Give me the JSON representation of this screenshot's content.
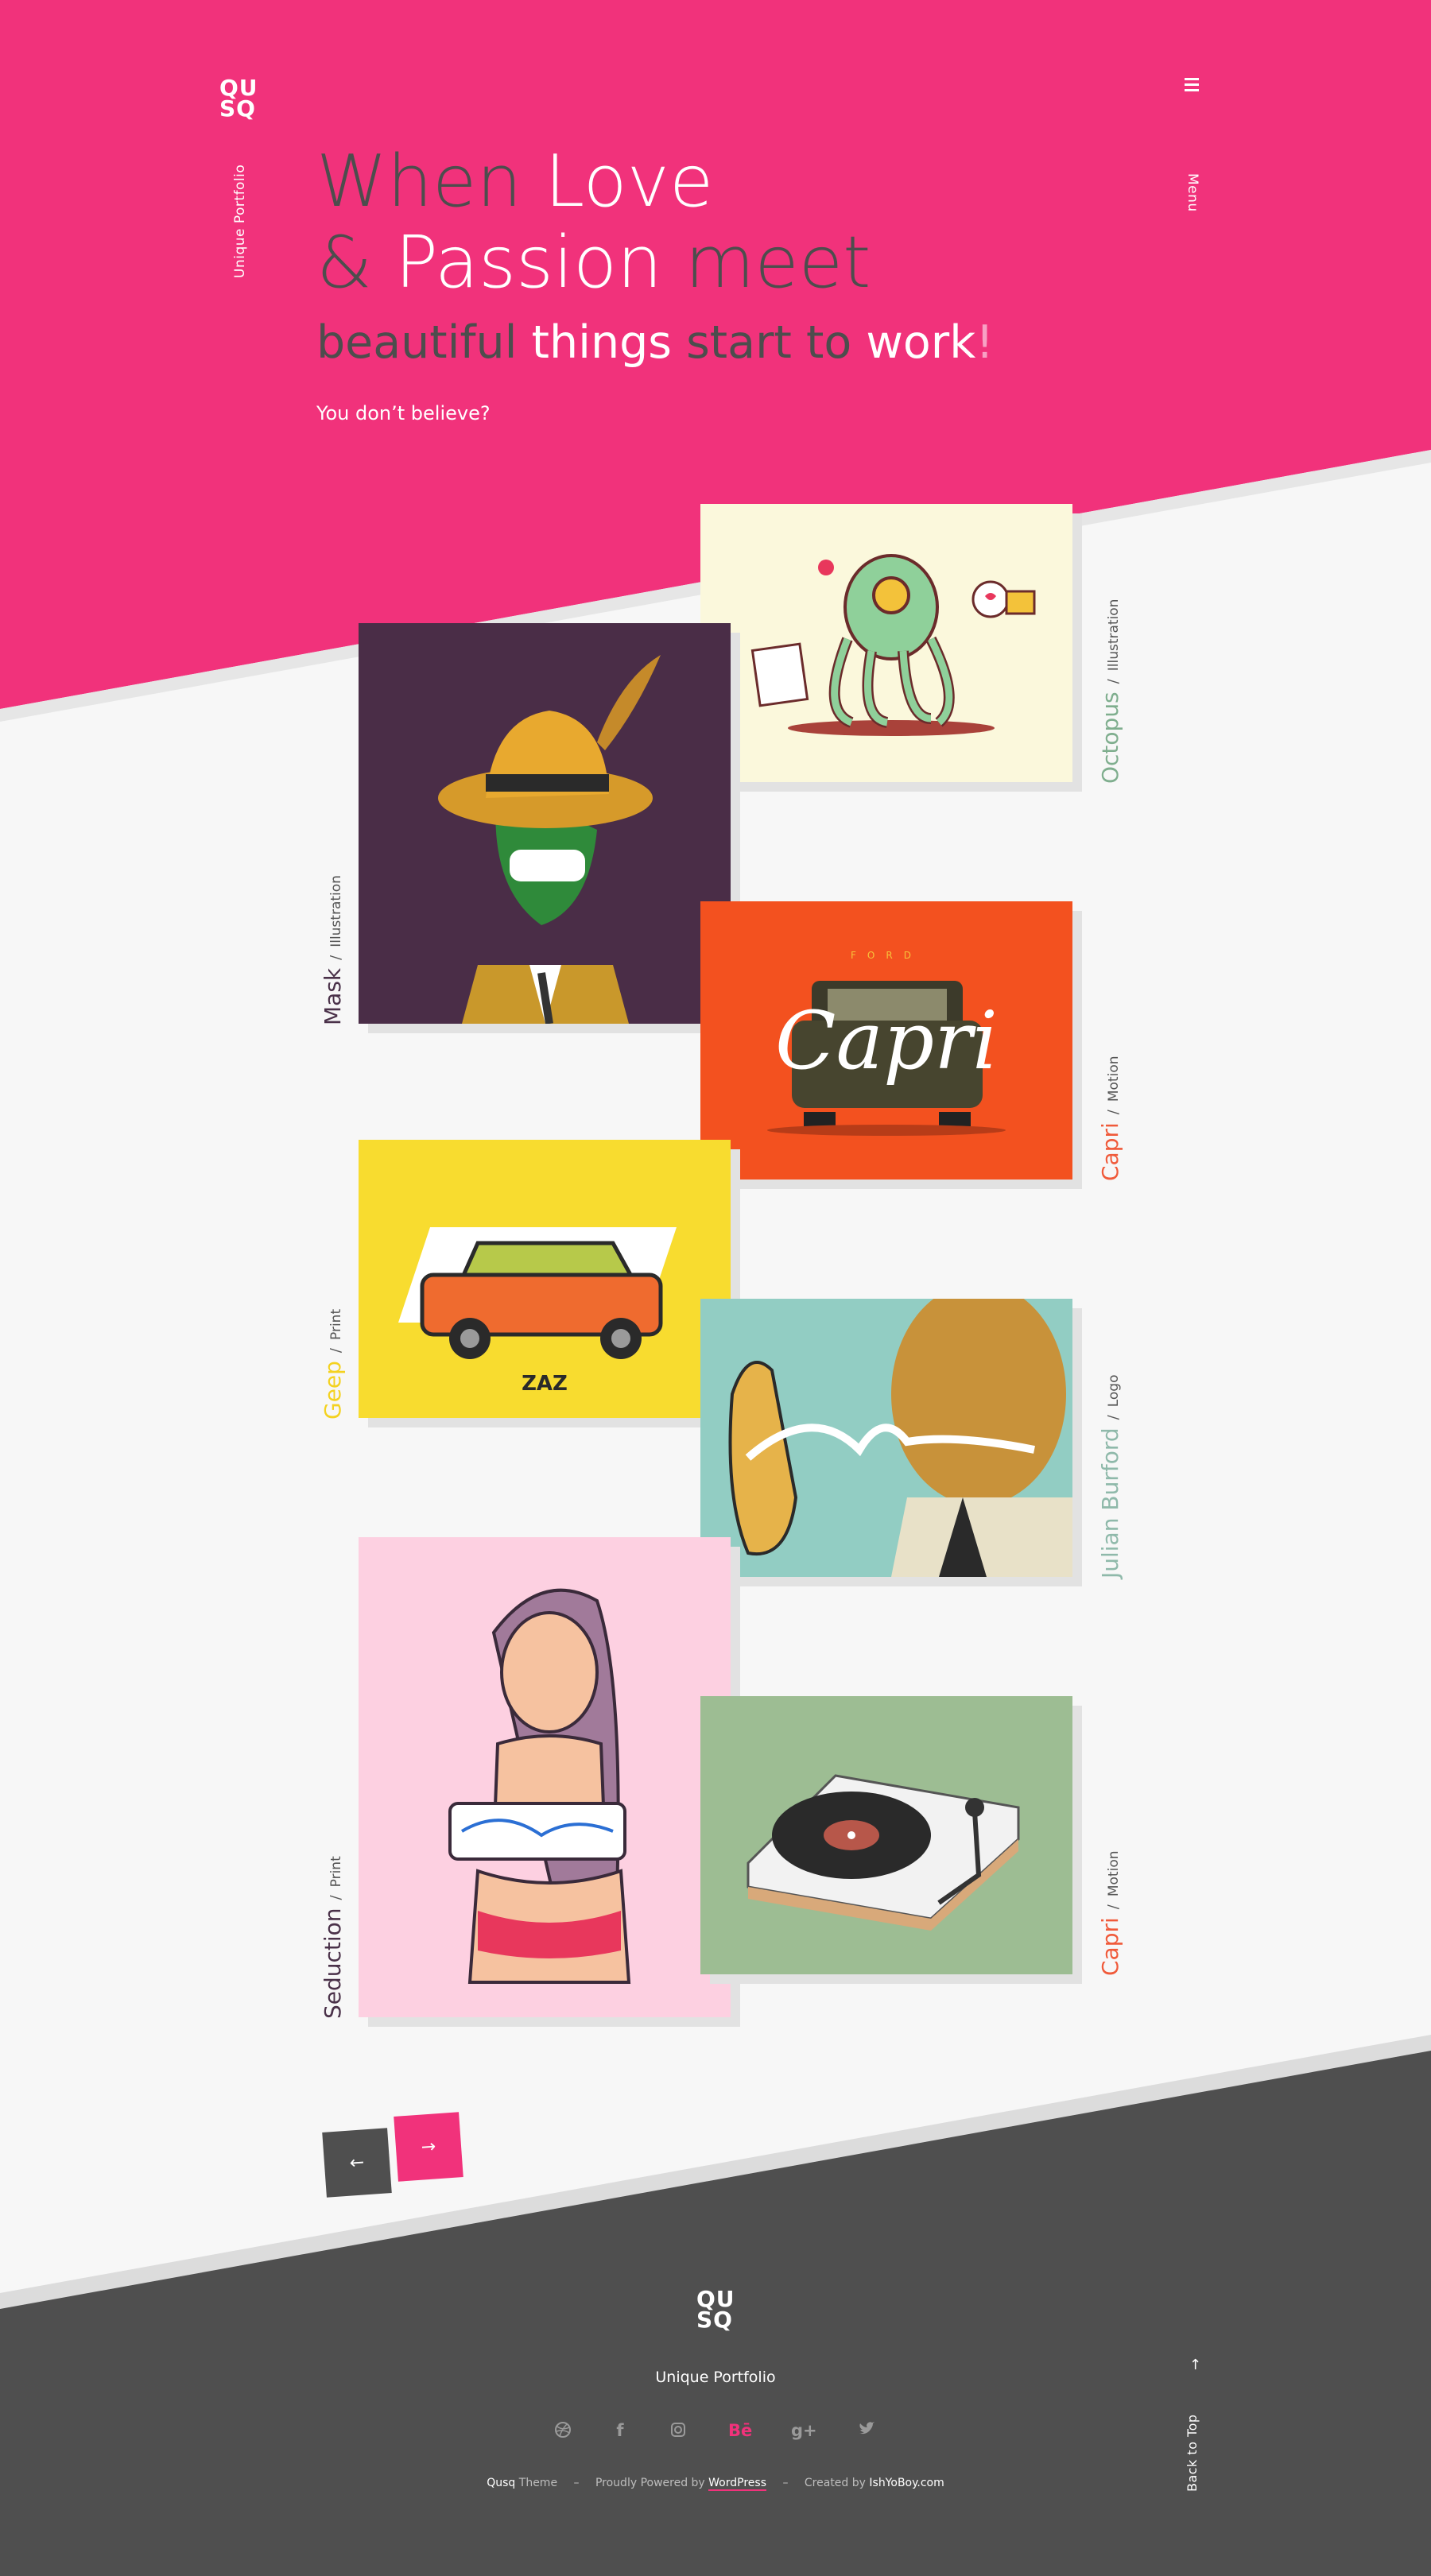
{
  "brand": {
    "logo_line1": "QU",
    "logo_line2": "SQ",
    "tagline": "Unique  Portfolio"
  },
  "header": {
    "menu_label": "Menu"
  },
  "hero": {
    "line1_a": "When ",
    "line1_b": "Love",
    "line2_a": "& ",
    "line2_b": "Passion",
    "line2_c": " meet",
    "sub_a": "beautiful ",
    "sub_b": "things",
    "sub_c": " start to ",
    "sub_d": "work",
    "sub_e": "!",
    "question": "You don’t believe?"
  },
  "portfolio": [
    {
      "title": "Octopus",
      "category": "Illustration",
      "title_color": "#7fae8e",
      "bg": "#fbf8dc"
    },
    {
      "title": "Mask",
      "category": "Illustration",
      "title_color": "#4a3149",
      "bg": "#4a2d47"
    },
    {
      "title": "Capri",
      "category": "Motion",
      "title_color": "#f05a3a",
      "bg": "#f3511f",
      "art_text": "Capri",
      "art_small": "FORD"
    },
    {
      "title": "Geep",
      "category": "Print",
      "title_color": "#f4d21f",
      "bg": "#f8dc2f",
      "art_text": "ZAZ"
    },
    {
      "title": "Julian Burford",
      "category": "Logo",
      "title_color": "#8fb9aa",
      "bg": "#92cdc3"
    },
    {
      "title": "Seduction",
      "category": "Print",
      "title_color": "#4a3149",
      "bg": "#fdd0e1"
    },
    {
      "title": "Capri",
      "category": "Motion",
      "title_color": "#f05a3a",
      "bg": "#9dbd93"
    }
  ],
  "pager": {
    "prev_label": "←",
    "next_label": "→"
  },
  "footer": {
    "theme_name": "Qusq",
    "theme_word": " Theme",
    "powered_text": "Proudly Powered by ",
    "powered_link": "WordPress",
    "created_text": "Created by ",
    "created_link": "IshYoBoy.com",
    "separator": "–",
    "back_to_top": "Back to Top",
    "social": [
      "dribbble-icon",
      "facebook-icon",
      "instagram-icon",
      "behance-icon",
      "google-plus-icon",
      "twitter-icon"
    ],
    "behance_label": "Bē"
  },
  "colors": {
    "accent": "#f1327b",
    "dark": "#4f4f4f"
  }
}
